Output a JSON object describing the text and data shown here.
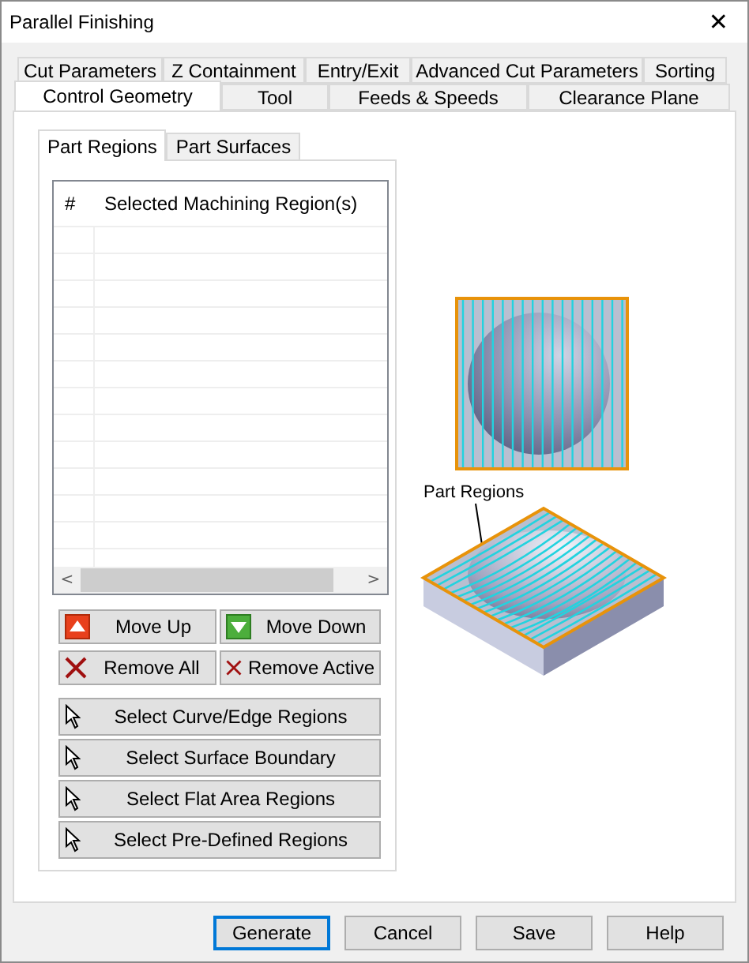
{
  "window": {
    "title": "Parallel Finishing",
    "close": "✕"
  },
  "tab_rows": [
    [
      {
        "label": "Cut Parameters",
        "selected": false
      },
      {
        "label": "Z Containment",
        "selected": false
      },
      {
        "label": "Entry/Exit",
        "selected": false
      },
      {
        "label": "Advanced Cut Parameters",
        "selected": false
      },
      {
        "label": "Sorting",
        "selected": false
      }
    ],
    [
      {
        "label": "Control Geometry",
        "selected": true
      },
      {
        "label": "Tool",
        "selected": false
      },
      {
        "label": "Feeds & Speeds",
        "selected": false
      },
      {
        "label": "Clearance Plane",
        "selected": false
      }
    ]
  ],
  "sub_tabs": [
    {
      "label": "Part Regions",
      "selected": true
    },
    {
      "label": "Part Surfaces",
      "selected": false
    }
  ],
  "region_list": {
    "columns": [
      "#",
      "Selected Machining Region(s)"
    ],
    "scroll_left": "<",
    "scroll_right": ">"
  },
  "list_buttons": [
    {
      "label": "Move Up",
      "kind": "up"
    },
    {
      "label": "Move Down",
      "kind": "down"
    },
    {
      "label": "Remove All",
      "kind": "remove"
    },
    {
      "label": "Remove Active",
      "kind": "remove"
    }
  ],
  "select_buttons": [
    {
      "label": "Select Curve/Edge Regions"
    },
    {
      "label": "Select Surface Boundary"
    },
    {
      "label": "Select Flat Area Regions"
    },
    {
      "label": "Select Pre-Defined Regions"
    }
  ],
  "illustration": {
    "label": "Part Regions"
  },
  "footer_buttons": [
    {
      "label": "Generate",
      "default": true
    },
    {
      "label": "Cancel",
      "default": false
    },
    {
      "label": "Save",
      "default": false
    },
    {
      "label": "Help",
      "default": false
    }
  ]
}
